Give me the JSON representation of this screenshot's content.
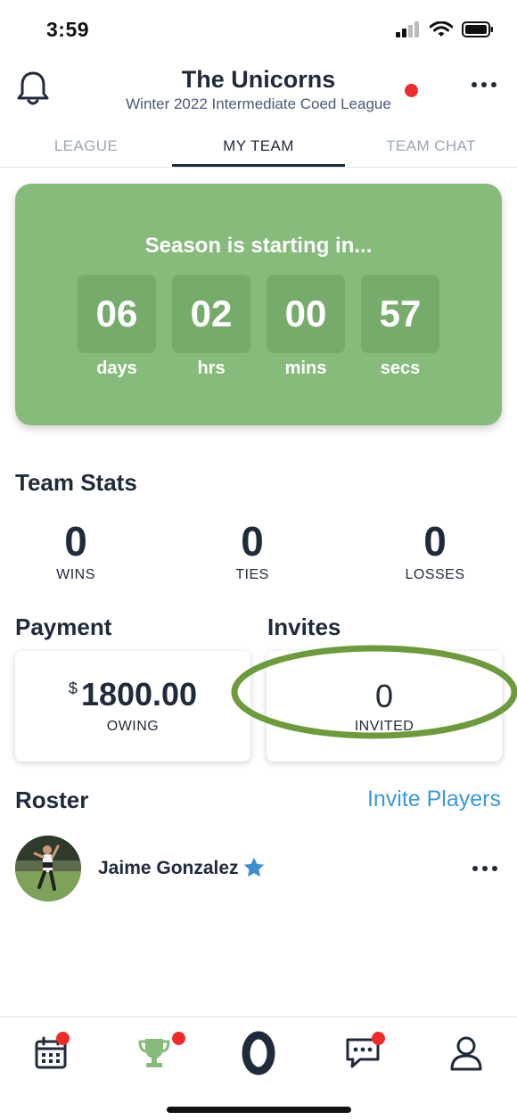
{
  "status_bar": {
    "time": "3:59"
  },
  "header": {
    "title": "The Unicorns",
    "subtitle": "Winter 2022 Intermediate Coed League"
  },
  "tabs": [
    {
      "label": "LEAGUE",
      "active": false
    },
    {
      "label": "MY TEAM",
      "active": true
    },
    {
      "label": "TEAM CHAT",
      "active": false
    }
  ],
  "countdown": {
    "title": "Season is starting in...",
    "units": [
      {
        "value": "06",
        "label": "days"
      },
      {
        "value": "02",
        "label": "hrs"
      },
      {
        "value": "00",
        "label": "mins"
      },
      {
        "value": "57",
        "label": "secs"
      }
    ]
  },
  "team_stats": {
    "heading": "Team Stats",
    "items": [
      {
        "value": "0",
        "label": "WINS"
      },
      {
        "value": "0",
        "label": "TIES"
      },
      {
        "value": "0",
        "label": "LOSSES"
      }
    ]
  },
  "payment": {
    "heading": "Payment",
    "currency": "$",
    "amount": "1800.00",
    "label": "OWING"
  },
  "invites": {
    "heading": "Invites",
    "value": "0",
    "label": "INVITED"
  },
  "roster": {
    "heading": "Roster",
    "invite_link": "Invite Players",
    "players": [
      {
        "name": "Jaime Gonzalez",
        "captain": true
      }
    ]
  },
  "bottom_nav": {
    "items": [
      "calendar-icon",
      "trophy-icon",
      "home-logo-icon",
      "chat-icon",
      "profile-icon"
    ]
  },
  "colors": {
    "accent_green": "#86bb7c",
    "dark_navy": "#1f2a3a",
    "link_blue": "#3a9ad6",
    "notification_red": "#ef2b2b",
    "highlight_ellipse": "#6d9a3a"
  }
}
